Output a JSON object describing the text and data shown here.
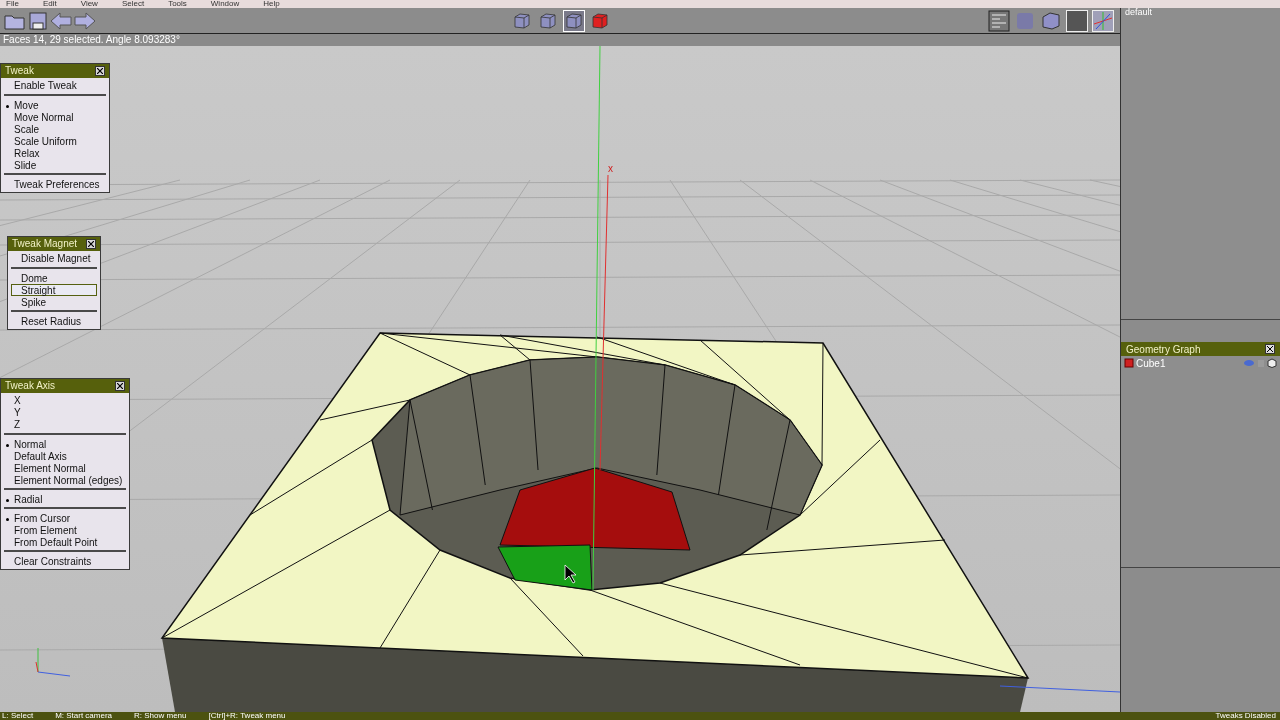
{
  "menu_bar": [
    "File",
    "Edit",
    "View",
    "Select",
    "Tools",
    "Window",
    "Help"
  ],
  "view_modes": [
    {
      "selected": false
    },
    {
      "selected": false
    },
    {
      "selected": true
    },
    {
      "selected": false
    }
  ],
  "info_line": "Faces 14, 29 selected. Angle 8.093283°",
  "viewport": {
    "axis_label": "x"
  },
  "panels": [
    {
      "title": "Tweak",
      "sections": [
        [
          {
            "label": "Enable Tweak"
          }
        ],
        [
          {
            "label": "Move",
            "kind": "radio",
            "selected": true
          },
          {
            "label": "Move Normal",
            "kind": "radio",
            "selected": false
          },
          {
            "label": "Scale",
            "kind": "radio",
            "selected": false
          },
          {
            "label": "Scale Uniform",
            "kind": "radio",
            "selected": false
          },
          {
            "label": "Relax",
            "kind": "radio",
            "selected": false
          },
          {
            "label": "Slide",
            "kind": "radio",
            "selected": false
          }
        ],
        [
          {
            "label": "Tweak Preferences"
          }
        ]
      ]
    },
    {
      "title": "Tweak Magnet",
      "sections": [
        [
          {
            "label": "Disable Magnet"
          }
        ],
        [
          {
            "label": "Dome",
            "kind": "option",
            "selected": false
          },
          {
            "label": "Straight",
            "kind": "option",
            "selected": true
          },
          {
            "label": "Spike",
            "kind": "option",
            "selected": false
          }
        ],
        [
          {
            "label": "Reset Radius"
          }
        ]
      ]
    },
    {
      "title": "Tweak Axis",
      "sections": [
        [
          {
            "label": "X"
          },
          {
            "label": "Y"
          },
          {
            "label": "Z"
          }
        ],
        [
          {
            "label": "Normal",
            "kind": "radio",
            "selected": true
          },
          {
            "label": "Default Axis",
            "kind": "radio",
            "selected": false
          },
          {
            "label": "Element Normal",
            "kind": "radio",
            "selected": false
          },
          {
            "label": "Element Normal (edges)",
            "kind": "radio",
            "selected": false
          }
        ],
        [
          {
            "label": "Radial",
            "kind": "radio",
            "selected": true
          }
        ],
        [
          {
            "label": "From Cursor",
            "kind": "radio",
            "selected": true
          },
          {
            "label": "From Element",
            "kind": "radio",
            "selected": false
          },
          {
            "label": "From Default Point",
            "kind": "radio",
            "selected": false
          }
        ],
        [
          {
            "label": "Clear Constraints"
          }
        ]
      ]
    }
  ],
  "outliner": {
    "items": [
      "default"
    ]
  },
  "geometry_graph": {
    "title": "Geometry Graph",
    "items": [
      {
        "name": "Cube1"
      }
    ]
  },
  "status_bar": {
    "hints": [
      "L: Select",
      "M: Start camera",
      "R: Show menu",
      "[Ctrl]+R: Tweak menu"
    ],
    "right": "Tweaks Disabled"
  }
}
